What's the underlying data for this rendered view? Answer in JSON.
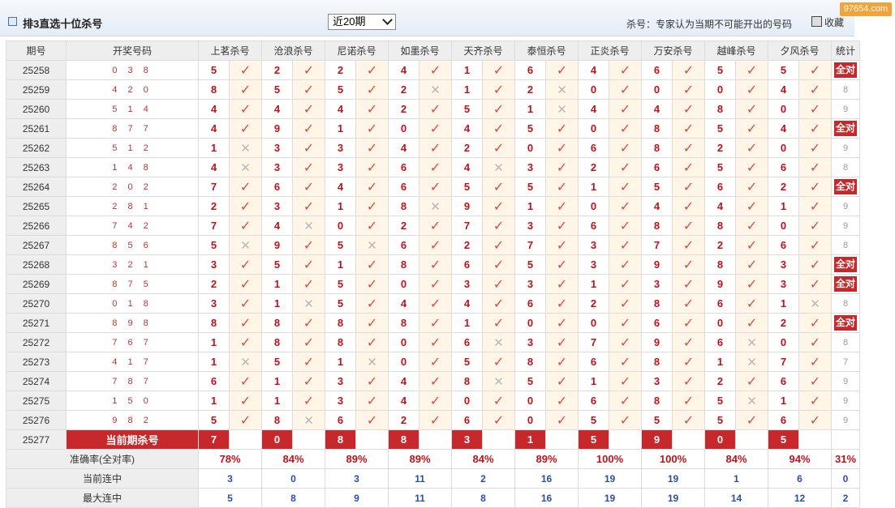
{
  "header": {
    "title": "排3直选十位杀号",
    "period_select": "近20期",
    "note": "杀号：专家认为当期不可能开出的号码",
    "favorite": "收藏",
    "watermark": "97654.com"
  },
  "columns": {
    "period": "期号",
    "winning": "开奖号码",
    "experts": [
      "上茗杀号",
      "沧浪杀号",
      "尼诺杀号",
      "如墨杀号",
      "天齐杀号",
      "泰恒杀号",
      "正炎杀号",
      "万安杀号",
      "越峰杀号",
      "夕风杀号"
    ],
    "stats": "统计"
  },
  "rows": [
    {
      "period": "25258",
      "win": "0 3 8",
      "k": [
        5,
        2,
        2,
        4,
        1,
        6,
        4,
        6,
        5,
        5
      ],
      "h": [
        1,
        1,
        1,
        1,
        1,
        1,
        1,
        1,
        1,
        1
      ],
      "s": "全对"
    },
    {
      "period": "25259",
      "win": "4 2 0",
      "k": [
        8,
        5,
        5,
        2,
        1,
        2,
        0,
        0,
        0,
        4
      ],
      "h": [
        1,
        1,
        1,
        0,
        1,
        0,
        1,
        1,
        1,
        1
      ],
      "s": "8"
    },
    {
      "period": "25260",
      "win": "5 1 4",
      "k": [
        4,
        4,
        4,
        2,
        5,
        1,
        4,
        4,
        8,
        0
      ],
      "h": [
        1,
        1,
        1,
        1,
        1,
        0,
        1,
        1,
        1,
        1
      ],
      "s": "9"
    },
    {
      "period": "25261",
      "win": "8 7 7",
      "k": [
        4,
        9,
        1,
        0,
        4,
        5,
        0,
        8,
        5,
        4
      ],
      "h": [
        1,
        1,
        1,
        1,
        1,
        1,
        1,
        1,
        1,
        1
      ],
      "s": "全对"
    },
    {
      "period": "25262",
      "win": "5 1 2",
      "k": [
        1,
        3,
        3,
        4,
        2,
        0,
        6,
        8,
        2,
        0
      ],
      "h": [
        0,
        1,
        1,
        1,
        1,
        1,
        1,
        1,
        1,
        1
      ],
      "s": "9"
    },
    {
      "period": "25263",
      "win": "1 4 8",
      "k": [
        4,
        3,
        3,
        6,
        4,
        3,
        2,
        6,
        5,
        6
      ],
      "h": [
        0,
        1,
        1,
        1,
        0,
        1,
        1,
        1,
        1,
        1
      ],
      "s": "8"
    },
    {
      "period": "25264",
      "win": "2 0 2",
      "k": [
        7,
        6,
        4,
        6,
        5,
        5,
        1,
        5,
        6,
        2
      ],
      "h": [
        1,
        1,
        1,
        1,
        1,
        1,
        1,
        1,
        1,
        1
      ],
      "s": "全对"
    },
    {
      "period": "25265",
      "win": "2 8 1",
      "k": [
        2,
        3,
        1,
        8,
        9,
        1,
        0,
        4,
        4,
        1
      ],
      "h": [
        1,
        1,
        1,
        0,
        1,
        1,
        1,
        1,
        1,
        1
      ],
      "s": "9"
    },
    {
      "period": "25266",
      "win": "7 4 2",
      "k": [
        7,
        4,
        0,
        2,
        7,
        3,
        6,
        8,
        8,
        0
      ],
      "h": [
        1,
        0,
        1,
        1,
        1,
        1,
        1,
        1,
        1,
        1
      ],
      "s": "9"
    },
    {
      "period": "25267",
      "win": "8 5 6",
      "k": [
        5,
        9,
        5,
        6,
        2,
        7,
        3,
        7,
        2,
        6
      ],
      "h": [
        0,
        1,
        0,
        1,
        1,
        1,
        1,
        1,
        1,
        1
      ],
      "s": "8"
    },
    {
      "period": "25268",
      "win": "3 2 1",
      "k": [
        3,
        5,
        1,
        8,
        6,
        5,
        3,
        9,
        8,
        3
      ],
      "h": [
        1,
        1,
        1,
        1,
        1,
        1,
        1,
        1,
        1,
        1
      ],
      "s": "全对"
    },
    {
      "period": "25269",
      "win": "8 7 5",
      "k": [
        2,
        1,
        5,
        0,
        3,
        3,
        1,
        3,
        9,
        3
      ],
      "h": [
        1,
        1,
        1,
        1,
        1,
        1,
        1,
        1,
        1,
        1
      ],
      "s": "全对"
    },
    {
      "period": "25270",
      "win": "0 1 8",
      "k": [
        3,
        1,
        5,
        4,
        4,
        6,
        2,
        8,
        6,
        1
      ],
      "h": [
        1,
        0,
        1,
        1,
        1,
        1,
        1,
        1,
        1,
        0
      ],
      "s": "8"
    },
    {
      "period": "25271",
      "win": "8 9 8",
      "k": [
        8,
        8,
        8,
        8,
        1,
        0,
        0,
        6,
        0,
        2
      ],
      "h": [
        1,
        1,
        1,
        1,
        1,
        1,
        1,
        1,
        1,
        1
      ],
      "s": "全对"
    },
    {
      "period": "25272",
      "win": "7 6 7",
      "k": [
        1,
        8,
        8,
        0,
        6,
        3,
        7,
        9,
        6,
        0
      ],
      "h": [
        1,
        1,
        1,
        1,
        0,
        1,
        1,
        1,
        0,
        1
      ],
      "s": "8"
    },
    {
      "period": "25273",
      "win": "4 1 7",
      "k": [
        1,
        5,
        1,
        0,
        5,
        8,
        6,
        8,
        1,
        7
      ],
      "h": [
        0,
        1,
        0,
        1,
        1,
        1,
        1,
        1,
        0,
        1
      ],
      "s": "7"
    },
    {
      "period": "25274",
      "win": "7 8 7",
      "k": [
        6,
        1,
        3,
        4,
        8,
        5,
        1,
        3,
        2,
        6
      ],
      "h": [
        1,
        1,
        1,
        1,
        0,
        1,
        1,
        1,
        1,
        1
      ],
      "s": "9"
    },
    {
      "period": "25275",
      "win": "1 5 0",
      "k": [
        1,
        1,
        3,
        4,
        0,
        0,
        6,
        8,
        5,
        1
      ],
      "h": [
        1,
        1,
        1,
        1,
        1,
        1,
        1,
        1,
        0,
        1
      ],
      "s": "9"
    },
    {
      "period": "25276",
      "win": "9 8 2",
      "k": [
        5,
        8,
        6,
        2,
        6,
        0,
        5,
        5,
        5,
        6
      ],
      "h": [
        1,
        0,
        1,
        1,
        1,
        1,
        1,
        1,
        1,
        1
      ],
      "s": "9"
    }
  ],
  "current": {
    "period": "25277",
    "label": "当前期杀号",
    "k": [
      7,
      0,
      8,
      8,
      3,
      1,
      5,
      9,
      0,
      5
    ]
  },
  "summary": {
    "accuracy_label": "准确率(全对率)",
    "accuracy": [
      "78%",
      "84%",
      "89%",
      "89%",
      "84%",
      "89%",
      "100%",
      "100%",
      "84%",
      "94%"
    ],
    "accuracy_stat": "31%",
    "streak_label": "当前连中",
    "streak": [
      "3",
      "0",
      "3",
      "11",
      "2",
      "16",
      "19",
      "19",
      "1",
      "6"
    ],
    "streak_stat": "0",
    "max_label": "最大连中",
    "max": [
      "5",
      "8",
      "9",
      "11",
      "8",
      "16",
      "19",
      "19",
      "14",
      "12"
    ],
    "max_stat": "2"
  },
  "marks": {
    "hit": "✓",
    "miss": "✕"
  },
  "colors": {
    "accent": "#c7282b",
    "hit": "#d94b4b",
    "miss": "#b8b8b8",
    "cell_bg": "#fff6e7",
    "header_bg": "#eeeeee"
  }
}
